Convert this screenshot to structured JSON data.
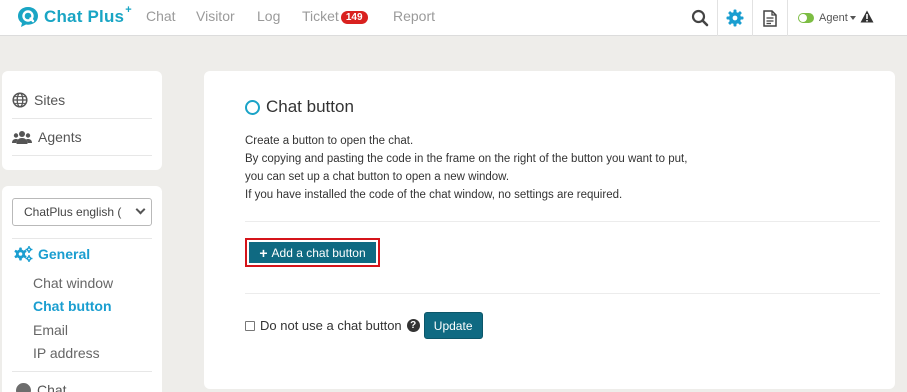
{
  "header": {
    "brand": "Chat Plus",
    "brand_sup": "+",
    "nav": {
      "chat": "Chat",
      "visitor": "Visitor",
      "log": "Log",
      "ticket": "Ticket",
      "ticket_count": "149",
      "report": "Report"
    },
    "agent_label": "Agent",
    "icons": [
      "search-icon",
      "gear-icon",
      "document-icon",
      "warning-icon"
    ]
  },
  "sidebar": {
    "links": {
      "sites": "Sites",
      "agents": "Agents"
    },
    "site_select_value": "ChatPlus english (",
    "section_title": "General",
    "items": {
      "chat_window": "Chat window",
      "chat_button": "Chat button",
      "email": "Email",
      "ip_address": "IP address"
    },
    "next_section": "Chat"
  },
  "main": {
    "title": "Chat button",
    "description": [
      "Create a button to open the chat.",
      "By copying and pasting the code in the frame on the right of the button you want to put,",
      "you can set up a chat button to open a new window.",
      "If you have installed the code of the chat window, no settings are required."
    ],
    "add_button_label": "Add a chat button",
    "checkbox_label": "Do not use a chat button",
    "update_label": "Update"
  },
  "colors": {
    "accent": "#1a9ed0",
    "button": "#0f6a82",
    "badge": "#d9211f",
    "highlight_border": "#d5141a"
  }
}
